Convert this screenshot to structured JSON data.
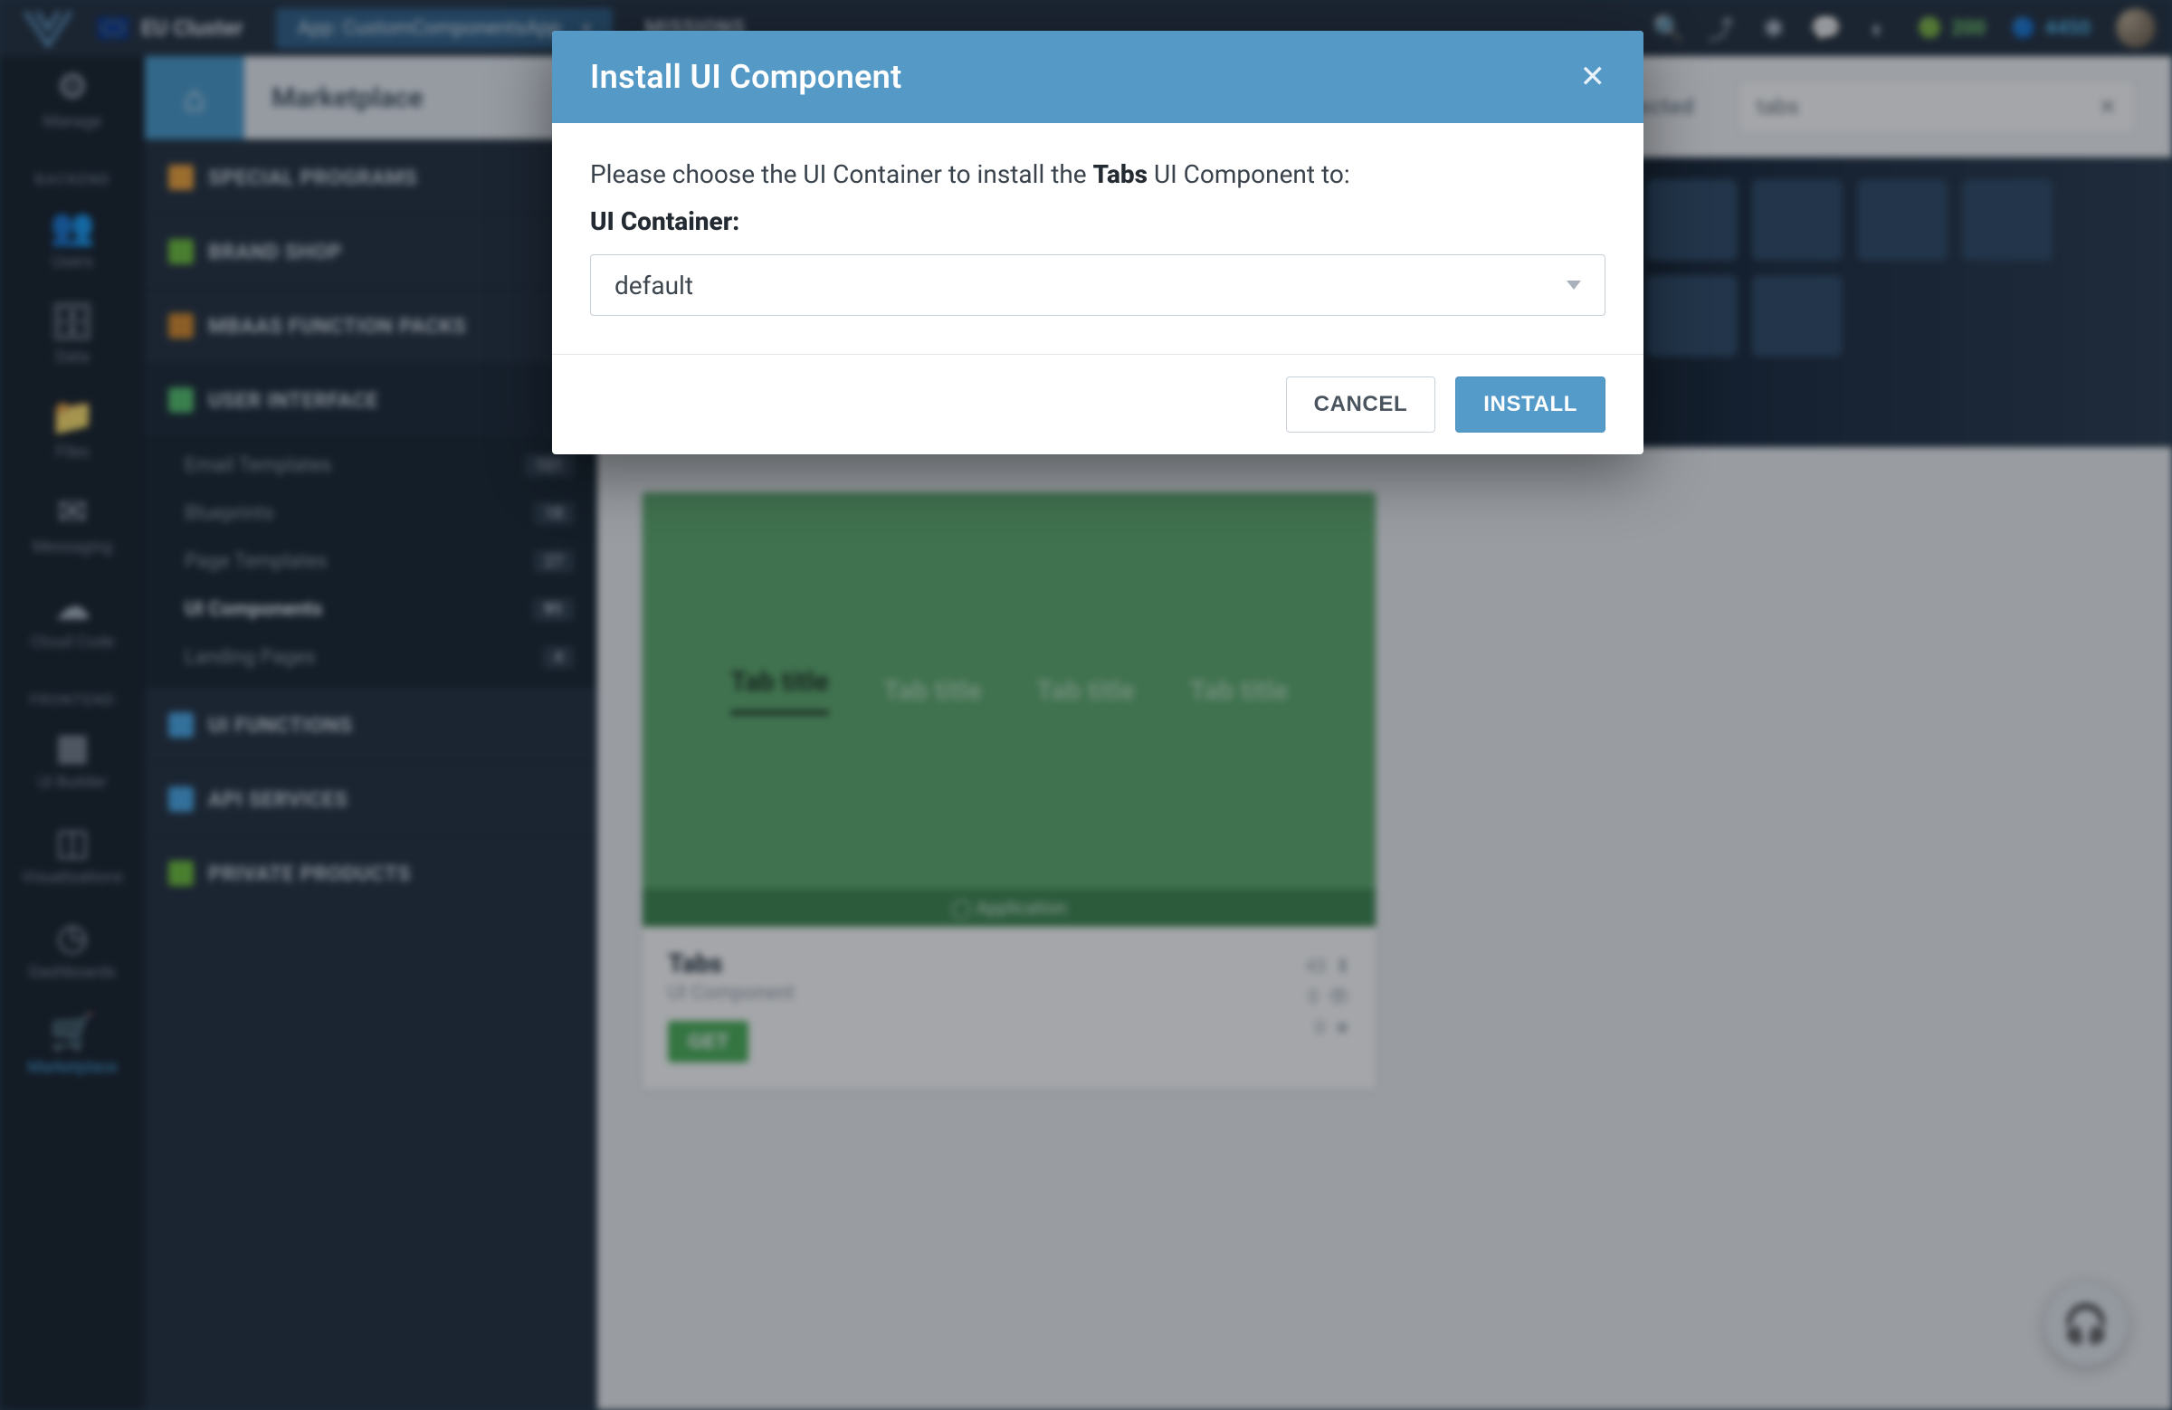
{
  "topbar": {
    "cluster_label": "EU Cluster",
    "app_prefix": "App:",
    "app_name": "CustomComponentsApp",
    "missions": "MISSIONS",
    "credits_green": "200",
    "credits_blue": "4450"
  },
  "rail": {
    "section_backend": "BACKEND",
    "section_frontend": "FRONTEND",
    "items": [
      {
        "label": "Manage"
      },
      {
        "label": "Users"
      },
      {
        "label": "Data"
      },
      {
        "label": "Files"
      },
      {
        "label": "Messaging"
      },
      {
        "label": "Cloud Code"
      },
      {
        "label": "UI Builder"
      },
      {
        "label": "Visualizations"
      },
      {
        "label": "Dashboards"
      },
      {
        "label": "Marketplace"
      }
    ]
  },
  "cats": {
    "marketplace_tab": "Marketplace",
    "special_programs": "SPECIAL PROGRAMS",
    "brand_shop": "BRAND SHOP",
    "mbaas": "MBAAS FUNCTION PACKS",
    "user_interface": "USER INTERFACE",
    "ui_functions": "UI FUNCTIONS",
    "api_services": "API SERVICES",
    "private_products": "PRIVATE PRODUCTS",
    "subitems": [
      {
        "label": "Email Templates",
        "count": "101"
      },
      {
        "label": "Blueprints",
        "count": "18"
      },
      {
        "label": "Page Templates",
        "count": "27"
      },
      {
        "label": "UI Components",
        "count": "91"
      },
      {
        "label": "Landing Pages",
        "count": "4"
      }
    ]
  },
  "filterbar": {
    "rejected": "Rejected",
    "search_value": "tabs"
  },
  "card": {
    "tab_title": "Tab title",
    "app_label": "◯ Application",
    "title": "Tabs",
    "subtitle": "UI Component",
    "get": "GET",
    "downloads": "43",
    "views": "0",
    "stars": "0"
  },
  "modal": {
    "title": "Install UI Component",
    "prompt_pre": "Please choose the UI Container to install the ",
    "prompt_bold": "Tabs",
    "prompt_post": " UI Component to:",
    "container_label": "UI Container:",
    "selected": "default",
    "cancel": "CANCEL",
    "install": "INSTALL"
  }
}
